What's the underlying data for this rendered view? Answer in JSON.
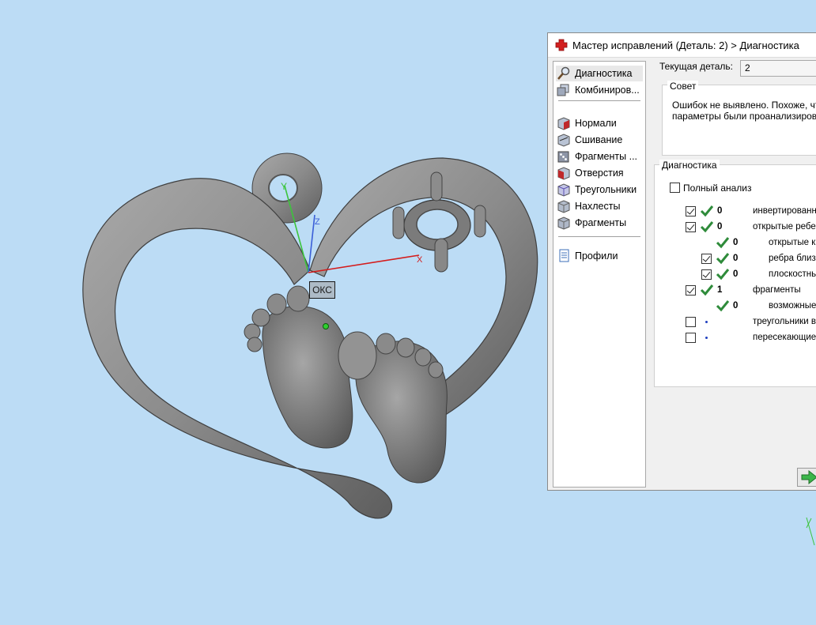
{
  "viewport": {
    "axis_labels": {
      "y": "Y",
      "z": "Z",
      "x": "X"
    },
    "origin_label": "ОКС",
    "colors": {
      "background": "#bcdcf5",
      "model": "#8a8a8a",
      "x_axis": "#d41c1c",
      "y_axis": "#3cc43c",
      "z_axis": "#3a5fd8"
    }
  },
  "dialog": {
    "title": "Мастер исправлений (Деталь: 2) > Диагностика",
    "title_icon": "red-cross-icon",
    "nav": {
      "items": [
        {
          "label": "Диагностика",
          "icon": "magnifier-icon",
          "selected": true
        },
        {
          "label": "Комбиниров...",
          "icon": "cubes-icon",
          "selected": false
        },
        {
          "label": "Нормали",
          "icon": "normals-cube-icon",
          "selected": false
        },
        {
          "label": "Сшивание",
          "icon": "stitch-cube-icon",
          "selected": false
        },
        {
          "label": "Фрагменты ...",
          "icon": "dice-icon",
          "selected": false
        },
        {
          "label": "Отверстия",
          "icon": "holes-cube-icon",
          "selected": false
        },
        {
          "label": "Треугольники",
          "icon": "triangles-cube-icon",
          "selected": false
        },
        {
          "label": "Нахлесты",
          "icon": "overlap-cube-icon",
          "selected": false
        },
        {
          "label": "Фрагменты",
          "icon": "shells-cube-icon",
          "selected": false
        },
        {
          "label": "Профили",
          "icon": "document-icon",
          "selected": false
        }
      ]
    },
    "current_part_label": "Текущая деталь:",
    "current_part_value": "2",
    "advice": {
      "caption": "Совет",
      "line1": "Ошибок не выявлено. Похоже, чт",
      "line2": "параметры были проанализирова"
    },
    "diagnostics": {
      "caption": "Диагностика",
      "full_analysis_label": "Полный анализ",
      "full_analysis_checked": false,
      "rows": [
        {
          "checked": true,
          "ok": true,
          "count": "0",
          "label": "инвертированн",
          "level": 0
        },
        {
          "checked": true,
          "ok": true,
          "count": "0",
          "label": "открытые ребе",
          "level": 0
        },
        {
          "checked": null,
          "ok": true,
          "count": "0",
          "label": "открытые к",
          "level": 1
        },
        {
          "checked": true,
          "ok": true,
          "count": "0",
          "label": "ребра близ",
          "level": 1
        },
        {
          "checked": true,
          "ok": true,
          "count": "0",
          "label": "плоскостнь",
          "level": 1
        },
        {
          "checked": true,
          "ok": true,
          "count": "1",
          "label": "фрагменты",
          "level": 0
        },
        {
          "checked": null,
          "ok": true,
          "count": "0",
          "label": "возможные",
          "level": 1
        },
        {
          "checked": false,
          "ok": false,
          "count": "",
          "label": "треугольники в",
          "level": 0
        },
        {
          "checked": false,
          "ok": false,
          "count": "",
          "label": "пересекающие",
          "level": 0
        }
      ]
    },
    "next_button_icon": "green-arrow-icon"
  }
}
